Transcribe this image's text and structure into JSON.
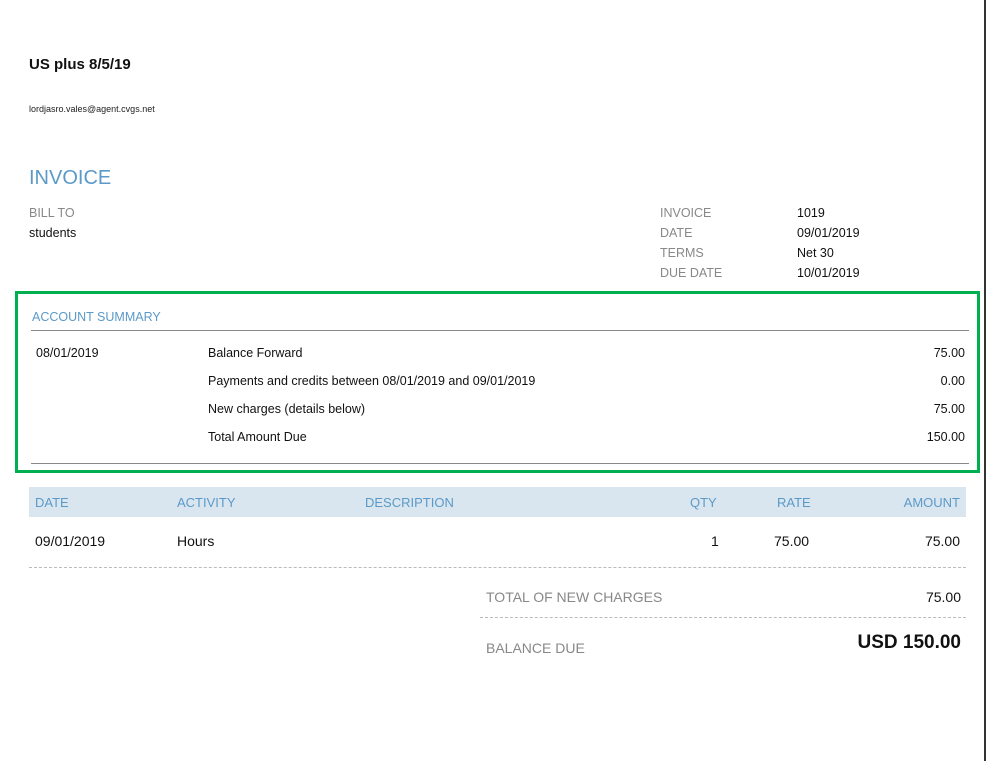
{
  "company": {
    "name": "US plus 8/5/19",
    "email": "lordjasro.vales@agent.cvgs.net"
  },
  "invoice_title": "INVOICE",
  "bill_to": {
    "label": "BILL TO",
    "value": "students"
  },
  "meta": [
    {
      "label": "INVOICE",
      "value": "1019"
    },
    {
      "label": "DATE",
      "value": "09/01/2019"
    },
    {
      "label": "TERMS",
      "value": "Net 30"
    },
    {
      "label": "DUE DATE",
      "value": "10/01/2019"
    }
  ],
  "account_summary": {
    "title": "ACCOUNT SUMMARY",
    "date": "08/01/2019",
    "rows": [
      {
        "label": "Balance Forward",
        "amount": "75.00"
      },
      {
        "label": "Payments and credits between 08/01/2019 and 09/01/2019",
        "amount": "0.00"
      },
      {
        "label": "New charges (details below)",
        "amount": "75.00"
      },
      {
        "label": "Total Amount Due",
        "amount": "150.00"
      }
    ]
  },
  "items": {
    "headers": {
      "date": "DATE",
      "activity": "ACTIVITY",
      "description": "DESCRIPTION",
      "qty": "QTY",
      "rate": "RATE",
      "amount": "AMOUNT"
    },
    "rows": [
      {
        "date": "09/01/2019",
        "activity": "Hours",
        "description": "",
        "qty": "1",
        "rate": "75.00",
        "amount": "75.00"
      }
    ]
  },
  "totals": {
    "new_charges_label": "TOTAL OF NEW CHARGES",
    "new_charges_value": "75.00",
    "balance_due_label": "BALANCE DUE",
    "balance_due_value": "USD 150.00"
  },
  "colors": {
    "accent": "#5b9ac8",
    "highlight_border": "#00b050",
    "header_bg": "#d9e6f0"
  }
}
